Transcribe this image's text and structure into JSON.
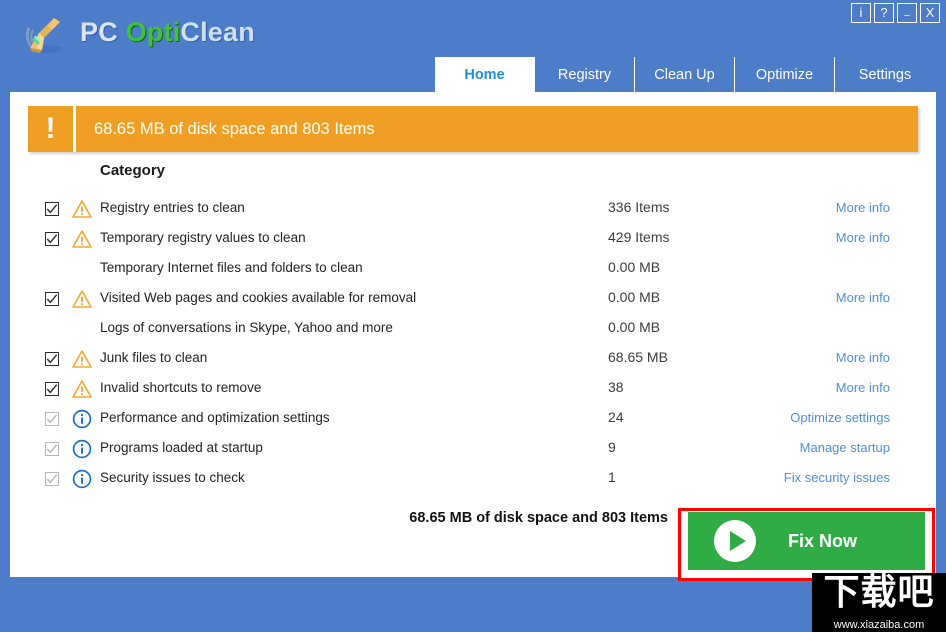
{
  "window": {
    "app_title_part1": "PC ",
    "app_title_part2": "Opti",
    "app_title_part3": "Clean",
    "logo_icon": "broom-icon",
    "buttons": [
      {
        "name": "info-button",
        "label": "i"
      },
      {
        "name": "help-button",
        "label": "?"
      },
      {
        "name": "minimize-button",
        "label": "–"
      },
      {
        "name": "close-button",
        "label": "X"
      }
    ]
  },
  "tabs": [
    {
      "label": "Home",
      "active": true
    },
    {
      "label": "Registry",
      "active": false
    },
    {
      "label": "Clean Up",
      "active": false
    },
    {
      "label": "Optimize",
      "active": false
    },
    {
      "label": "Settings",
      "active": false
    }
  ],
  "banner": {
    "icon": "exclamation-icon",
    "icon_glyph": "!",
    "text": "68.65 MB of disk space and 803 Items",
    "bg_color": "#efa024"
  },
  "table": {
    "header": "Category",
    "rows": [
      {
        "checked": true,
        "checkbox": true,
        "severity": "warning",
        "label": "Registry entries to clean",
        "value": "336 Items",
        "link": "More info"
      },
      {
        "checked": true,
        "checkbox": true,
        "severity": "warning",
        "label": "Temporary registry values to clean",
        "value": "429 Items",
        "link": "More info"
      },
      {
        "checked": false,
        "checkbox": false,
        "severity": "none",
        "label": "Temporary Internet files and folders to clean",
        "value": "0.00 MB",
        "link": ""
      },
      {
        "checked": true,
        "checkbox": true,
        "severity": "warning",
        "label": "Visited Web pages and cookies available for removal",
        "value": "0.00 MB",
        "link": "More info"
      },
      {
        "checked": false,
        "checkbox": false,
        "severity": "none",
        "label": "Logs of conversations in Skype, Yahoo and more",
        "value": "0.00 MB",
        "link": ""
      },
      {
        "checked": true,
        "checkbox": true,
        "severity": "warning",
        "label": "Junk files to clean",
        "value": "68.65 MB",
        "link": "More info"
      },
      {
        "checked": true,
        "checkbox": true,
        "severity": "warning",
        "label": "Invalid shortcuts to remove",
        "value": "38",
        "link": "More info"
      },
      {
        "checked": true,
        "checkbox": "dim",
        "severity": "info",
        "label": "Performance and optimization settings",
        "value": "24",
        "link": "Optimize settings"
      },
      {
        "checked": true,
        "checkbox": "dim",
        "severity": "info",
        "label": "Programs loaded at startup",
        "value": "9",
        "link": "Manage startup"
      },
      {
        "checked": true,
        "checkbox": "dim",
        "severity": "info",
        "label": "Security issues to check",
        "value": "1",
        "link": "Fix security issues"
      }
    ]
  },
  "footer": {
    "summary": "68.65 MB of disk space and 803 Items",
    "fix_button_label": "Fix Now",
    "fix_button_color": "#2fac46",
    "highlight_color": "#ff0000"
  },
  "watermark": {
    "text_cn": "下载吧",
    "url": "www.xiazaiba.com"
  },
  "colors": {
    "window_blue": "#4d7cc8",
    "tab_active_text": "#1a8fe0",
    "link_blue": "#4e8fd6",
    "warning_orange": "#f0a830",
    "info_blue": "#1a6fc4"
  }
}
